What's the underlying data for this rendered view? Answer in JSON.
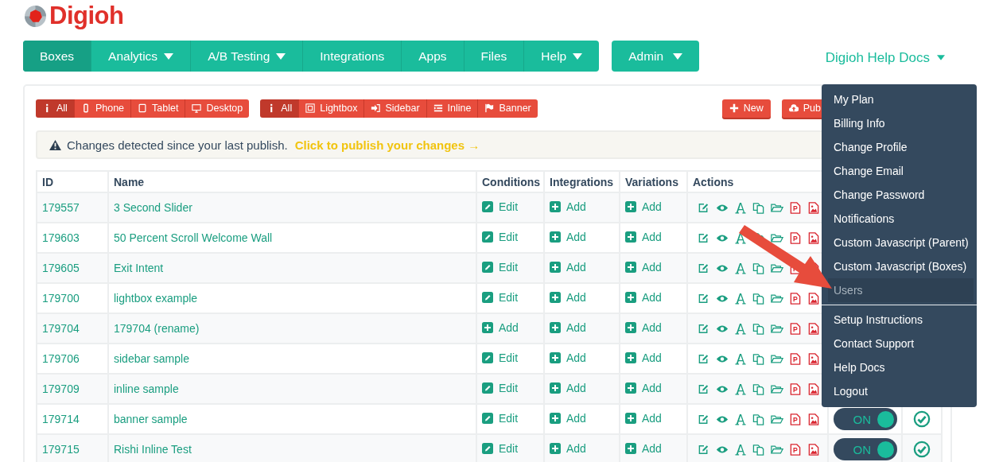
{
  "logo": {
    "name": "Digioh"
  },
  "nav": {
    "items": [
      {
        "label": "Boxes",
        "selected": true,
        "caret": false
      },
      {
        "label": "Analytics",
        "selected": false,
        "caret": true
      },
      {
        "label": "A/B Testing",
        "selected": false,
        "caret": true
      },
      {
        "label": "Integrations",
        "selected": false,
        "caret": false
      },
      {
        "label": "Apps",
        "selected": false,
        "caret": false
      },
      {
        "label": "Files",
        "selected": false,
        "caret": false
      },
      {
        "label": "Help",
        "selected": false,
        "caret": true
      }
    ],
    "admin": {
      "label": "Admin",
      "caret": true
    },
    "help_docs": {
      "label": "Digioh Help Docs",
      "caret": true
    }
  },
  "filters": [
    [
      {
        "label": "All",
        "kind": "info",
        "selected": true
      },
      {
        "label": "Phone",
        "kind": "phone",
        "selected": false
      },
      {
        "label": "Tablet",
        "kind": "tablet",
        "selected": false
      },
      {
        "label": "Desktop",
        "kind": "desktop",
        "selected": false
      }
    ],
    [
      {
        "label": "All",
        "kind": "info",
        "selected": true
      },
      {
        "label": "Lightbox",
        "kind": "lightbox",
        "selected": false
      },
      {
        "label": "Sidebar",
        "kind": "sidebar",
        "selected": false
      },
      {
        "label": "Inline",
        "kind": "inline",
        "selected": false
      },
      {
        "label": "Banner",
        "kind": "banner",
        "selected": false
      }
    ]
  ],
  "actions": [
    {
      "label": "New",
      "kind": "new"
    },
    {
      "label": "Pub",
      "kind": "publish"
    }
  ],
  "alert": {
    "text": "Changes detected since your last publish.",
    "link": "Click to publish your changes →"
  },
  "table": {
    "columns": [
      "ID",
      "Name",
      "Conditions",
      "Integrations",
      "Variations",
      "Actions"
    ],
    "rows": [
      {
        "id": "179557",
        "name": "3 Second Slider",
        "condition": {
          "kind": "edit",
          "label": "Edit"
        },
        "integration": "Add",
        "variation": "Add"
      },
      {
        "id": "179603",
        "name": "50 Percent Scroll Welcome Wall",
        "condition": {
          "kind": "edit",
          "label": "Edit"
        },
        "integration": "Add",
        "variation": "Add"
      },
      {
        "id": "179605",
        "name": "Exit Intent",
        "condition": {
          "kind": "edit",
          "label": "Edit"
        },
        "integration": "Add",
        "variation": "Add"
      },
      {
        "id": "179700",
        "name": "lightbox example",
        "condition": {
          "kind": "edit",
          "label": "Edit"
        },
        "integration": "Add",
        "variation": "Add"
      },
      {
        "id": "179704",
        "name": "179704 (rename)",
        "condition": {
          "kind": "add",
          "label": "Add"
        },
        "integration": "Add",
        "variation": "Add"
      },
      {
        "id": "179706",
        "name": "sidebar sample",
        "condition": {
          "kind": "edit",
          "label": "Edit"
        },
        "integration": "Add",
        "variation": "Add"
      },
      {
        "id": "179709",
        "name": "inline sample",
        "condition": {
          "kind": "edit",
          "label": "Edit"
        },
        "integration": "Add",
        "variation": "Add"
      },
      {
        "id": "179714",
        "name": "banner sample",
        "condition": {
          "kind": "edit",
          "label": "Edit"
        },
        "integration": "Add",
        "variation": "Add",
        "toggle": {
          "label": "ON",
          "on": true
        },
        "verified": true
      },
      {
        "id": "179715",
        "name": "Rishi Inline Test",
        "condition": {
          "kind": "edit",
          "label": "Edit"
        },
        "integration": "Add",
        "variation": "Add",
        "toggle": {
          "label": "ON",
          "on": true
        },
        "verified": true
      }
    ]
  },
  "menu": {
    "groups": [
      [
        {
          "label": "My Plan",
          "selected": false
        },
        {
          "label": "Billing Info",
          "selected": false
        },
        {
          "label": "Change Profile",
          "selected": false
        },
        {
          "label": "Change Email",
          "selected": false
        },
        {
          "label": "Change Password",
          "selected": false
        },
        {
          "label": "Notifications",
          "selected": false
        },
        {
          "label": "Custom Javascript (Parent)",
          "selected": false
        },
        {
          "label": "Custom Javascript (Boxes)",
          "selected": false
        },
        {
          "label": "Users",
          "selected": true
        }
      ],
      [
        {
          "label": "Setup Instructions",
          "selected": false
        },
        {
          "label": "Contact Support",
          "selected": false
        },
        {
          "label": "Help Docs",
          "selected": false
        },
        {
          "label": "Logout",
          "selected": false
        }
      ]
    ]
  }
}
